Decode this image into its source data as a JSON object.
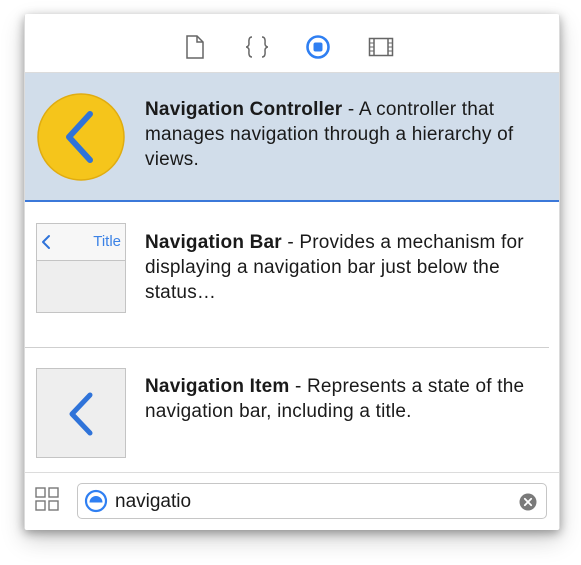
{
  "toolbar": {
    "tabs": [
      {
        "icon": "file-icon",
        "selected": false
      },
      {
        "icon": "braces-icon",
        "selected": false
      },
      {
        "icon": "object-library-icon",
        "selected": true
      },
      {
        "icon": "media-library-icon",
        "selected": false
      }
    ],
    "accent": "#2f7ff2"
  },
  "items": [
    {
      "name": "Navigation Controller",
      "separator": " - ",
      "description": "A controller that manages navigation through a hierarchy of views.",
      "icon": "navigation-controller-icon",
      "selected": true
    },
    {
      "name": "Navigation Bar",
      "separator": " - ",
      "description": "Provides a mechanism for displaying a navigation bar just below the status…",
      "icon": "navigation-bar-icon",
      "thumb_title": "Title",
      "selected": false
    },
    {
      "name": "Navigation Item",
      "separator": " - ",
      "description": "Represents a state of the navigation bar, including a title.",
      "icon": "navigation-item-icon",
      "selected": false
    }
  ],
  "search": {
    "value": "navigatio"
  },
  "colors": {
    "selected_row": "#d1ddea",
    "selection_border": "#3b78d9",
    "controller_badge": "#f5c51b",
    "chevron": "#2f73d9"
  }
}
